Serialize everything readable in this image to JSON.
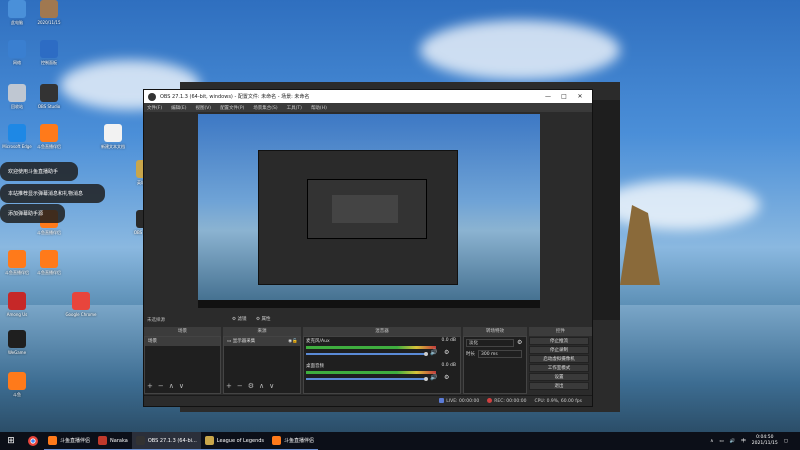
{
  "desktop": {
    "icons": [
      {
        "label": "此电脑",
        "color": "#4a90d9"
      },
      {
        "label": "2020/11/15",
        "color": "#a07850"
      },
      {
        "label": "网络",
        "color": "#3a7fd0"
      },
      {
        "label": "控制面板",
        "color": "#2d6cc4"
      },
      {
        "label": "回收站",
        "color": "#bfc7d2"
      },
      {
        "label": "OBS Studio",
        "color": "#333"
      },
      {
        "label": "Microsoft Edge",
        "color": "#1e88e5"
      },
      {
        "label": "斗鱼直播伴侣",
        "color": "#ff7a1a"
      },
      {
        "label": "新建文本文档",
        "color": "#f2f2f2"
      },
      {
        "label": "英雄联盟",
        "color": "#c9a64a"
      },
      {
        "label": "OBS Studio",
        "color": "#2a2a2a"
      },
      {
        "label": "斗鱼直播伴侣",
        "color": "#ff7a1a"
      },
      {
        "label": "斗鱼直播伴侣",
        "color": "#ff7a1a"
      },
      {
        "label": "斗鱼直播伴侣",
        "color": "#ff7a1a"
      },
      {
        "label": "Among Us",
        "color": "#c62828"
      },
      {
        "label": "Google Chrome",
        "color": "#e8453c"
      },
      {
        "label": "WeGame",
        "color": "#1f1f1f"
      },
      {
        "label": "斗鱼",
        "color": "#ff7a1a"
      }
    ],
    "tooltips": [
      "欢迎使用斗鱼直播助手",
      "本站推荐显示弹幕消息和礼物消息",
      "添加弹幕助手源"
    ]
  },
  "obs": {
    "title": "OBS 27.1.3 (64-bit, windows) - 配置文件: 未命名 - 场景: 未命名",
    "menu": [
      "文件(F)",
      "编辑(E)",
      "视图(V)",
      "配置文件(P)",
      "场景集合(S)",
      "工具(T)",
      "帮助(H)"
    ],
    "status_label": "未选择源",
    "filters_label": "滤镜",
    "properties_label": "属性",
    "docks": {
      "scenes": {
        "header": "场景",
        "items": [
          "场景"
        ]
      },
      "sources": {
        "header": "来源",
        "items": [
          "显示器采集"
        ]
      },
      "mixer": {
        "header": "混音器",
        "tracks": [
          {
            "name": "麦克风/Aux",
            "level": "0.0 dB"
          },
          {
            "name": "桌面音频",
            "level": "0.0 dB"
          }
        ]
      },
      "transitions": {
        "header": "转场特效",
        "type": "淡化",
        "duration_label": "时长",
        "duration": "300 ms"
      },
      "controls": {
        "header": "控件",
        "buttons": [
          "停止推流",
          "停止录制",
          "启动虚拟摄像机",
          "工作室模式",
          "设置",
          "退出"
        ]
      }
    },
    "statusbar": {
      "live": "LIVE: 00:00:00",
      "rec": "REC: 00:00:00",
      "cpu": "CPU: 0.9%, 60.00 fps"
    }
  },
  "taskbar": {
    "tasks": [
      {
        "label": "斗鱼直播伴侣",
        "color": "#ff7a1a"
      },
      {
        "label": "Naraka",
        "color": "#c0392b"
      },
      {
        "label": "OBS 27.1.3 (64-bi...",
        "color": "#333"
      },
      {
        "label": "League of Legends",
        "color": "#c9a64a"
      },
      {
        "label": "斗鱼直播伴侣",
        "color": "#ff7a1a"
      }
    ],
    "time": "0:04:50",
    "date": "2021/11/15",
    "lang": "中"
  }
}
